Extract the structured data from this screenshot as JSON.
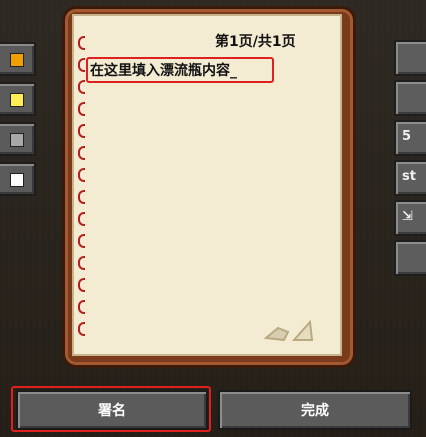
{
  "book": {
    "page_indicator": "第1页/共1页",
    "text_field": {
      "value": "在这里填入漂流瓶内容_"
    }
  },
  "left_color_buttons": [
    {
      "name": "orange-color-button",
      "color": "#f0a000"
    },
    {
      "name": "yellow-color-button",
      "color": "#ffee55"
    },
    {
      "name": "gray-color-button",
      "color": "#a8a8a8"
    },
    {
      "name": "white-color-button",
      "color": "#ffffff"
    }
  ],
  "right_buttons": [
    {
      "label": ""
    },
    {
      "label": ""
    },
    {
      "label": "5"
    },
    {
      "label": "st"
    },
    {
      "label": "⇲"
    },
    {
      "label": ""
    }
  ],
  "bottom": {
    "sign_label": "署名",
    "done_label": "完成"
  },
  "colors": {
    "highlight": "#e0201e",
    "book_cover": "#7a3a1c",
    "page": "#f4ecd2"
  }
}
